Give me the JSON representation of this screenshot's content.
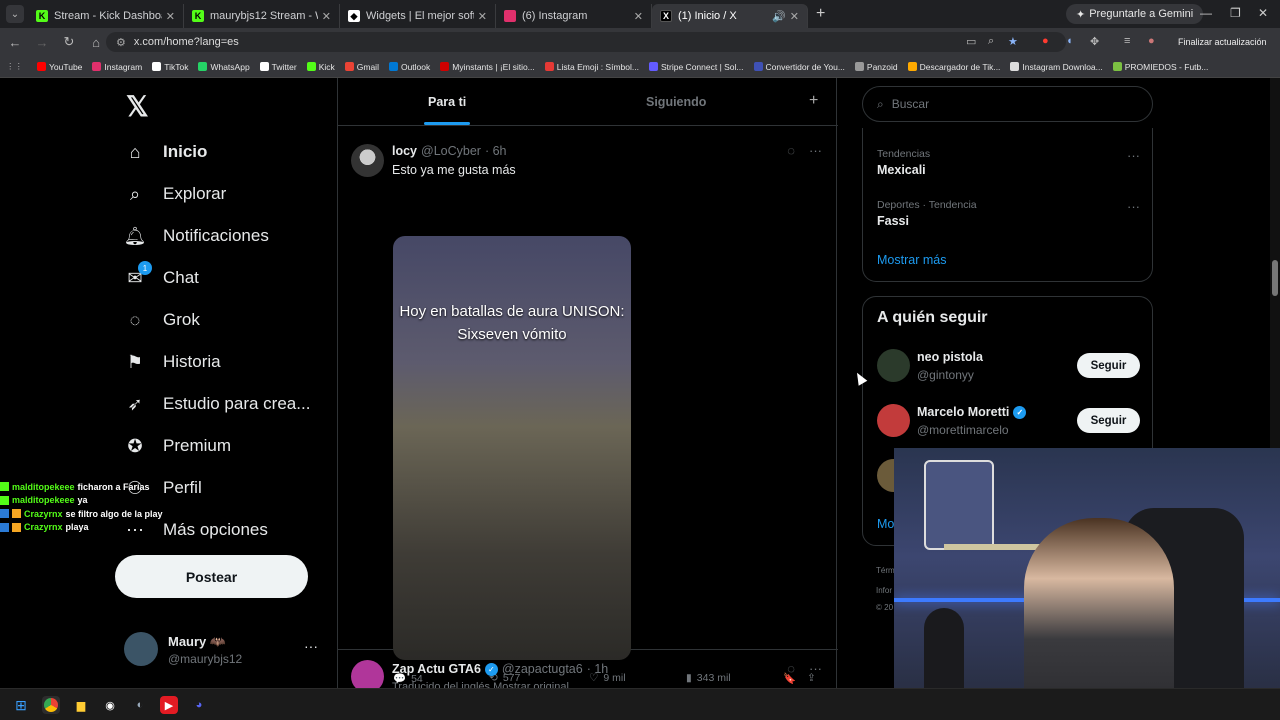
{
  "browser": {
    "tabs": [
      {
        "title": "Stream - Kick Dashboard",
        "icon": "kick-icon",
        "color": "#53fc18",
        "active": false
      },
      {
        "title": "maurybjs12 Stream - Watch Live",
        "icon": "kick-icon",
        "color": "#53fc18",
        "active": false
      },
      {
        "title": "Widgets | El mejor software para",
        "icon": "widgets-icon",
        "color": "#ffffff",
        "active": false
      },
      {
        "title": "(6) Instagram",
        "icon": "instagram-icon",
        "color": "#e1306c",
        "active": false
      },
      {
        "title": "(1) Inicio / X",
        "icon": "x-icon",
        "color": "#ffffff",
        "active": true
      }
    ],
    "gemini_label": "Preguntarle a Gemini",
    "url": "x.com/home?lang=es",
    "update_label": "Finalizar actualización",
    "bookmarks": [
      {
        "label": "YouTube",
        "color": "#ff0000"
      },
      {
        "label": "Instagram",
        "color": "#e1306c"
      },
      {
        "label": "TikTok",
        "color": "#ffffff"
      },
      {
        "label": "WhatsApp",
        "color": "#25d366"
      },
      {
        "label": "Twitter",
        "color": "#ffffff"
      },
      {
        "label": "Kick",
        "color": "#53fc18"
      },
      {
        "label": "Gmail",
        "color": "#ea4335"
      },
      {
        "label": "Outlook",
        "color": "#0078d4"
      },
      {
        "label": "Myinstants | ¡El sitio...",
        "color": "#d00000"
      },
      {
        "label": "Lista Emoji : Símbol...",
        "color": "#e53935"
      },
      {
        "label": "Stripe Connect | Sol...",
        "color": "#635bff"
      },
      {
        "label": "Convertidor de You...",
        "color": "#3f51b5"
      },
      {
        "label": "Panzoid",
        "color": "#999999"
      },
      {
        "label": "Descargador de Tik...",
        "color": "#ffaa00"
      },
      {
        "label": "Instagram Downloa...",
        "color": "#dddddd"
      },
      {
        "label": "PROMIEDOS - Futb...",
        "color": "#7cc142"
      }
    ]
  },
  "sidebar": {
    "items": [
      {
        "label": "Inicio",
        "icon": "home-icon"
      },
      {
        "label": "Explorar",
        "icon": "search-icon"
      },
      {
        "label": "Notificaciones",
        "icon": "bell-icon"
      },
      {
        "label": "Chat",
        "icon": "chat-icon"
      },
      {
        "label": "Grok",
        "icon": "grok-icon"
      },
      {
        "label": "Historia",
        "icon": "bookmark-icon"
      },
      {
        "label": "Estudio para crea...",
        "icon": "rocket-icon"
      },
      {
        "label": "Premium",
        "icon": "premium-icon"
      },
      {
        "label": "Perfil",
        "icon": "profile-icon"
      },
      {
        "label": "Más opciones",
        "icon": "more-icon"
      }
    ],
    "chat_badge": "1",
    "post_label": "Postear",
    "account": {
      "name": "Maury",
      "handle": "@maurybjs12"
    }
  },
  "feed": {
    "tabs": [
      "Para ti",
      "Siguiendo"
    ],
    "tweet1": {
      "name": "locy",
      "handle": "@LoCyber",
      "time": "· 6h",
      "text": "Esto ya me gusta más",
      "media_caption_line1": "Hoy en batallas de aura UNISON:",
      "media_caption_line2": "Sixseven vómito",
      "replies": "54",
      "reposts": "577",
      "likes": "9 mil",
      "views": "343 mil"
    },
    "tweet2": {
      "name": "Zap Actu GTA6",
      "handle": "@zapactugta6",
      "time": "· 1h",
      "subtext": "Traducido del inglés Mostrar original"
    }
  },
  "right": {
    "search_placeholder": "Buscar",
    "trends": [
      {
        "category": "Tendencias",
        "title": "Mexicali"
      },
      {
        "category": "Deportes · Tendencia",
        "title": "Fassi"
      }
    ],
    "show_more": "Mostrar más",
    "who_to_follow_title": "A quién seguir",
    "follows": [
      {
        "name": "neo pistola",
        "handle": "@gintonyy",
        "verified": false
      },
      {
        "name": "Marcelo Moretti",
        "handle": "@morettimarcelo",
        "verified": true
      }
    ],
    "follow_label": "Seguir",
    "show_more_short": "Mo",
    "footer": [
      "Térm",
      "Infor",
      "© 20"
    ]
  },
  "chat_overlay": [
    {
      "user": "malditopekeee",
      "message": "ficharon a Farías"
    },
    {
      "user": "malditopekeee",
      "message": "ya"
    },
    {
      "user": "Crazyrnx",
      "message": "se filtro algo de la play"
    },
    {
      "user": "Crazyrnx",
      "message": "playa"
    }
  ]
}
